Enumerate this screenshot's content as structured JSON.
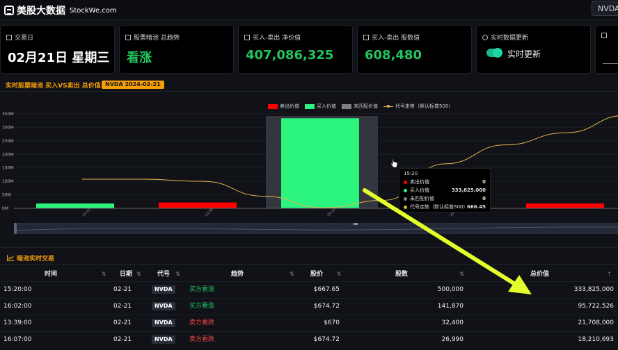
{
  "brand": {
    "title": "美股大数据",
    "domain": "StockWe.com"
  },
  "ticker_button": "NVDA",
  "cards": [
    {
      "label": "交易日",
      "value": "02月21日 星期三",
      "icon": "calendar-icon"
    },
    {
      "label": "股票暗池 总趋势",
      "value": "看涨",
      "icon": "chart-icon"
    },
    {
      "label": "买入-卖出 净价值",
      "value": "407,086,325",
      "icon": "money-icon"
    },
    {
      "label": "买入-卖出 股数值",
      "value": "608,480",
      "icon": "shares-icon"
    },
    {
      "label": "实时数据更新",
      "value": "实时更新",
      "icon": "realtime-icon"
    },
    {
      "label": "",
      "value": "",
      "icon": "calendar-icon"
    }
  ],
  "panel": {
    "title": "实时股票暗池 买入VS卖出 总价值",
    "badge": "NVDA 2024-02-21"
  },
  "colors": {
    "sell": "#ff0000",
    "buy": "#2cf57f",
    "unmatched": "#808080",
    "trend": "#e0b44c",
    "accent": "#f59e0b"
  },
  "chart_data": {
    "type": "bar",
    "legend": [
      "卖出价值",
      "买入价值",
      "未匹配价值",
      "代号走势（默认标普500）"
    ],
    "y_ticks": [
      "0M",
      "50M",
      "100M",
      "150M",
      "200M",
      "250M",
      "300M",
      "350M"
    ],
    "ylim": [
      0,
      350
    ],
    "categories": [
      "13:21",
      "13:39",
      "15:20",
      "16:..",
      ""
    ],
    "series": [
      {
        "name": "卖出价值",
        "values": [
          0,
          21.708,
          0,
          0,
          18.2
        ]
      },
      {
        "name": "买入价值",
        "values": [
          18,
          0,
          333.825,
          95.722526,
          0
        ]
      },
      {
        "name": "未匹配价值",
        "values": [
          0,
          0,
          0,
          0,
          0
        ]
      }
    ],
    "trend": {
      "name": "代号走势（默认标普500）",
      "values": [
        108,
        108,
        100,
        45,
        2,
        30,
        165,
        235,
        280,
        345
      ]
    },
    "highlight_category": "15:20",
    "tooltip": {
      "time": "15:20",
      "rows": [
        {
          "name": "卖出价值",
          "value": "0"
        },
        {
          "name": "买入价值",
          "value": "333,825,000"
        },
        {
          "name": "未匹配价值",
          "value": "0"
        },
        {
          "name": "代号走势（默认标普500）",
          "value": "666.45"
        }
      ]
    }
  },
  "trades": {
    "title": "暗池实时交易",
    "columns": [
      "时间",
      "日期",
      "代号",
      "趋势",
      "股价",
      "股数",
      "总价值"
    ],
    "rows": [
      {
        "time": "15:20:00",
        "date": "02-21",
        "ticker": "NVDA",
        "trend": "买方看涨",
        "side": "buy",
        "price": "$667.65",
        "shares": "500,000",
        "total": "333,825,000"
      },
      {
        "time": "16:02:00",
        "date": "02-21",
        "ticker": "NVDA",
        "trend": "买方看涨",
        "side": "buy",
        "price": "$674.72",
        "shares": "141,870",
        "total": "95,722,526"
      },
      {
        "time": "13:39:00",
        "date": "02-21",
        "ticker": "NVDA",
        "trend": "卖方看跌",
        "side": "sell",
        "price": "$670",
        "shares": "32,400",
        "total": "21,708,000"
      },
      {
        "time": "16:07:00",
        "date": "02-21",
        "ticker": "NVDA",
        "trend": "卖方看跌",
        "side": "sell",
        "price": "$674.72",
        "shares": "26,990",
        "total": "18,210,693"
      }
    ]
  }
}
